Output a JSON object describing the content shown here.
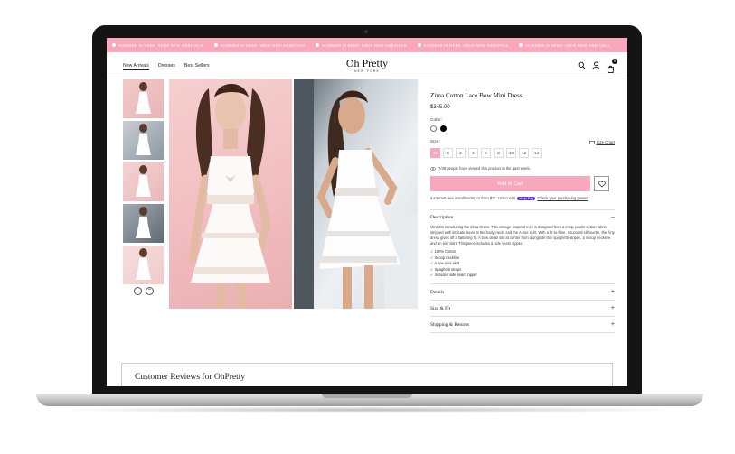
{
  "announcement": {
    "items": [
      "SUMMER IS HERE. SHOP NEW ARRIVALS",
      "SUMMER IS HERE. SHOP NEW ARRIVALS",
      "SUMMER IS HERE. SHOP NEW ARRIVALS",
      "SUMMER IS HERE. SHOP NEW ARRIVALS",
      "SUMMER IS HERE. SHOP NEW ARRIVALS"
    ],
    "color": "#f7a8bd"
  },
  "header": {
    "nav": [
      "New Arrivals",
      "Dresses",
      "Best Sellers"
    ],
    "logo_main": "Oh Pretty",
    "logo_sub": "NEW YORK",
    "icons": [
      "search-icon",
      "account-icon",
      "cart-icon"
    ],
    "cart_count": "0"
  },
  "gallery": {
    "thumbnail_count": 5,
    "icons": [
      "chevron-down-icon",
      "chevron-up-icon"
    ]
  },
  "product": {
    "title": "Zima Cotton Lace Bow Mini Dress",
    "price": "$345.00",
    "color_label": "Color:",
    "colors": [
      "#ffffff",
      "#000000"
    ],
    "size_label": "Size:",
    "size_guide": "Size Chart",
    "sizes": [
      "00",
      "0",
      "2",
      "4",
      "6",
      "8",
      "10",
      "12",
      "14"
    ],
    "selected_size": "00",
    "views_text": "7/48 people have viewed this product in the past week.",
    "add_to_cart": "Add to Cart",
    "installments_pre": "4 interest-free installments, or from $31.14/mo with",
    "shop_pay": "shop Pay",
    "installments_link": "Check your purchasing power"
  },
  "accordion": {
    "description_title": "Description",
    "description_text": "MiniMini introducing the Zima Dress. This vintage-inspired mini is designed from a crisp, poplin cotton fabric stripped with intricate laces at the body, neck, and the A-line skirt. With a fit-to-flare, structural silhouette, the flirty dress gives off a flattering fit. A bow detail sits at center from alongside thin spaghetti-stripes, a scoop neckline, and an airy skirt. This piece includes a side seam zipper.",
    "bullets": [
      "✓ 100% Cotton",
      "✓ Scoop neckline",
      "✓ A-line mini skirt",
      "✓ Spaghetti straps",
      "✓ Includes side seam zipper"
    ],
    "sections": [
      "Details",
      "Size & Fit",
      "Shipping & Returns"
    ],
    "expanded_sign": "−",
    "collapsed_sign": "+"
  },
  "reviews": {
    "title": "Customer Reviews for OhPretty"
  }
}
